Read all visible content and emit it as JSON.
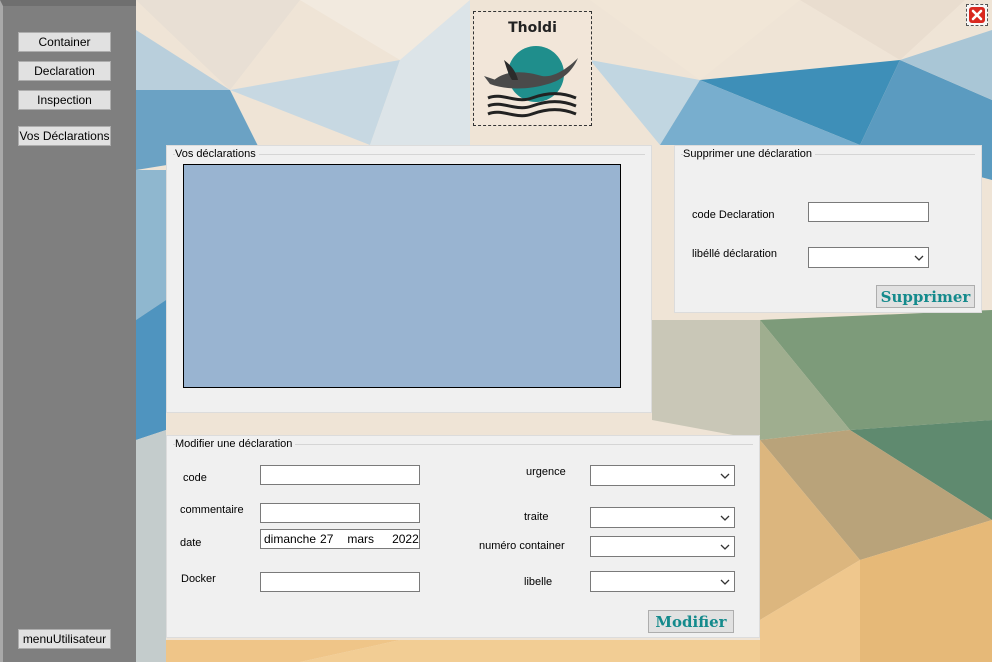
{
  "sidebar": {
    "items": [
      {
        "label": "Container"
      },
      {
        "label": "Declaration"
      },
      {
        "label": "Inspection"
      },
      {
        "label": "Vos Déclarations"
      }
    ],
    "bottom_button": {
      "label": "menuUtilisateur"
    }
  },
  "logo": {
    "title": "Tholdi"
  },
  "declarations_panel": {
    "title": "Vos déclarations"
  },
  "delete_panel": {
    "title": "Supprimer une déclaration",
    "code_label": "code Declaration",
    "libelle_label": "libéllé déclaration",
    "code_value": "",
    "libelle_value": "",
    "button_label": "Supprimer"
  },
  "edit_panel": {
    "title": "Modifier une déclaration",
    "code_label": "code",
    "commentaire_label": "commentaire",
    "date_label": "date",
    "docker_label": "Docker",
    "urgence_label": "urgence",
    "traite_label": "traite",
    "numero_container_label": "numéro container",
    "libelle_label": "libelle",
    "code_value": "",
    "commentaire_value": "",
    "docker_value": "",
    "date": {
      "day_name": "dimanche",
      "day": "27",
      "month": "mars",
      "year": "2022"
    },
    "urgence_value": "",
    "traite_value": "",
    "numero_container_value": "",
    "libelle_value": "",
    "button_label": "Modifier"
  },
  "colors": {
    "sidebar": "#7f7f7f",
    "listbox": "#99b4d1",
    "accent_text": "#148a8c",
    "close_red": "#d9281f"
  }
}
